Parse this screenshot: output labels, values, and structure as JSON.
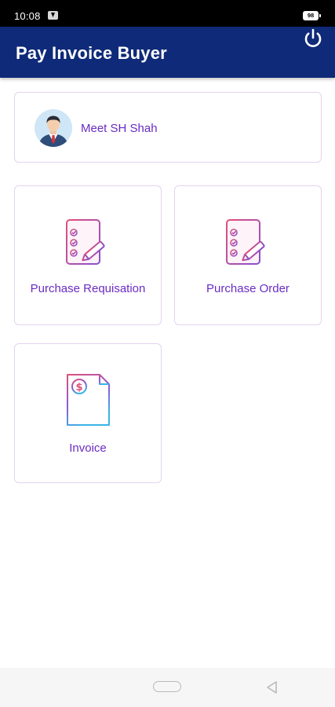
{
  "status_bar": {
    "time": "10:08",
    "battery": "98"
  },
  "app_bar": {
    "title": "Pay Invoice Buyer",
    "power_icon": "power-icon"
  },
  "profile": {
    "name": "Meet SH Shah",
    "avatar_icon": "user-avatar"
  },
  "tiles": [
    {
      "label": "Purchase Requisation",
      "icon": "checklist-pen-icon"
    },
    {
      "label": "Purchase Order",
      "icon": "checklist-pen-icon"
    },
    {
      "label": "Invoice",
      "icon": "invoice-dollar-icon"
    }
  ],
  "colors": {
    "app_bar": "#0f2a78",
    "accent_text": "#6a2cc2",
    "card_border": "#e3d4ee",
    "icon_gradient_start": "#e0507a",
    "icon_gradient_end": "#39b5e6"
  }
}
